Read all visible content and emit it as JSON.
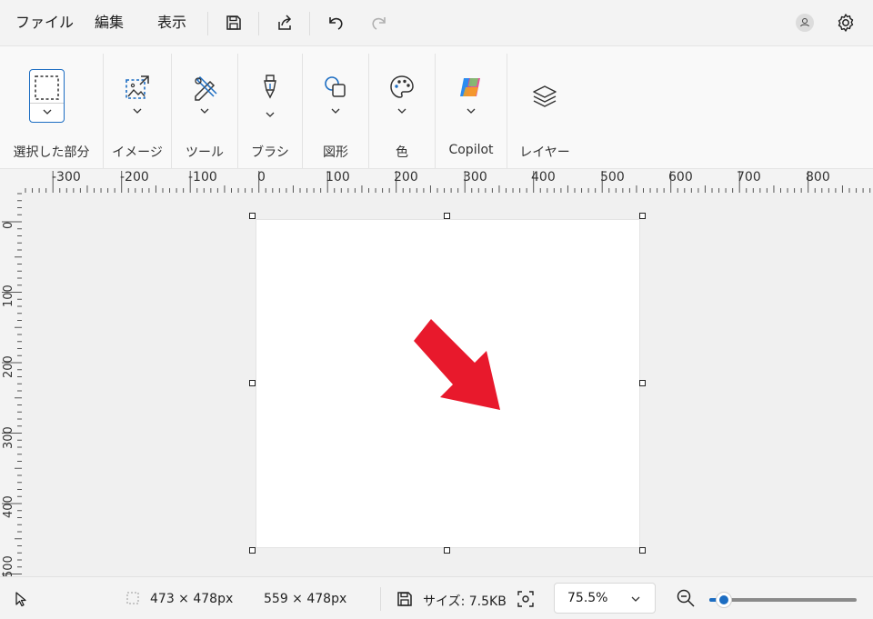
{
  "menu": {
    "file": "ファイル",
    "edit": "編集",
    "view": "表示"
  },
  "ribbon": {
    "groups": [
      {
        "label": "選択した部分",
        "icon": "selection-icon"
      },
      {
        "label": "イメージ",
        "icon": "image-icon"
      },
      {
        "label": "ツール",
        "icon": "tools-icon"
      },
      {
        "label": "ブラシ",
        "icon": "brush-icon"
      },
      {
        "label": "図形",
        "icon": "shapes-icon"
      },
      {
        "label": "色",
        "icon": "palette-icon"
      },
      {
        "label": "Copilot",
        "icon": "copilot-icon"
      },
      {
        "label": "レイヤー",
        "icon": "layers-icon"
      }
    ]
  },
  "ruler": {
    "horizontal": [
      "-300",
      "-200",
      "-100",
      "0",
      "100",
      "200",
      "300",
      "400",
      "500",
      "600",
      "700",
      "800"
    ],
    "vertical": [
      "0",
      "100",
      "200",
      "300",
      "400",
      "500"
    ]
  },
  "status": {
    "selection_size": "473 × 478px",
    "canvas_size": "559 × 478px",
    "file_size": "サイズ: 7.5KB",
    "zoom": "75.5%",
    "zoom_level": 0.1
  },
  "colors": {
    "accent": "#1c6dc2",
    "arrow": "#e8192c"
  }
}
